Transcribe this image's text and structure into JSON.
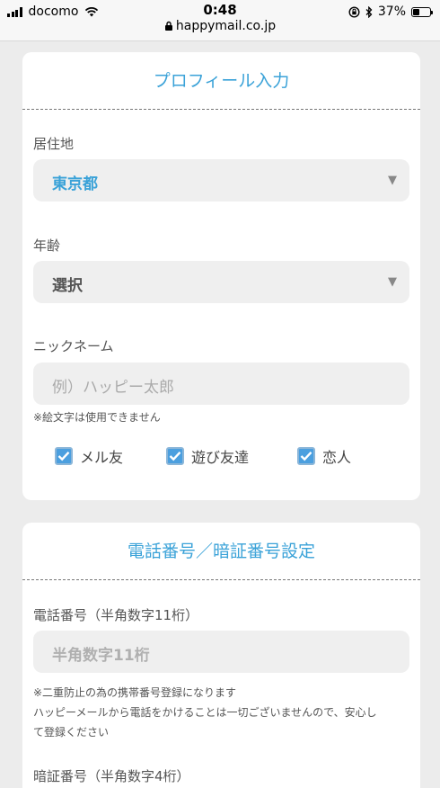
{
  "status_bar": {
    "carrier": "docomo",
    "time": "0:48",
    "url": "happymail.co.jp",
    "battery": "37%"
  },
  "profile": {
    "title": "プロフィール入力",
    "residence": {
      "label": "居住地",
      "value": "東京都"
    },
    "age": {
      "label": "年齢",
      "value": "選択"
    },
    "nickname": {
      "label": "ニックネーム",
      "placeholder": "例）ハッピー太郎",
      "note": "※絵文字は使用できません"
    },
    "purposes": [
      {
        "label": "メル友",
        "checked": true
      },
      {
        "label": "遊び友達",
        "checked": true
      },
      {
        "label": "恋人",
        "checked": true
      }
    ]
  },
  "phone_section": {
    "title": "電話番号／暗証番号設定",
    "phone": {
      "label": "電話番号（半角数字11桁）",
      "placeholder": "半角数字11桁",
      "note_line1": "※二重防止の為の携帯番号登録になります",
      "note_line2": "ハッピーメールから電話をかけることは一切ございませんので、安心し",
      "note_line3": "て登録ください"
    },
    "pin": {
      "label": "暗証番号（半角数字4桁）"
    }
  },
  "colors": {
    "accent": "#3aa2d8",
    "checkbox": "#4b9fdf"
  }
}
